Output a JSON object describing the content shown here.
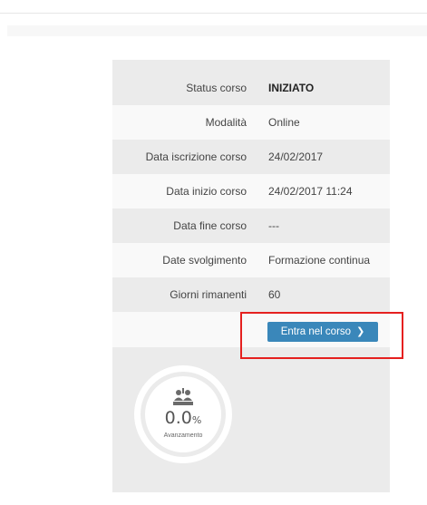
{
  "course_info": {
    "rows": [
      {
        "label": "Status corso",
        "value": "INIZIATO"
      },
      {
        "label": "Modalità",
        "value": "Online"
      },
      {
        "label": "Data iscrizione corso",
        "value": "24/02/2017"
      },
      {
        "label": "Data inizio corso",
        "value": "24/02/2017 11:24"
      },
      {
        "label": "Data fine corso",
        "value": "---"
      },
      {
        "label": "Date svolgimento",
        "value": "Formazione continua"
      },
      {
        "label": "Giorni rimanenti",
        "value": "60"
      }
    ]
  },
  "actions": {
    "enter_label": "Entra nel corso",
    "enter_icon": "chevron-right-icon"
  },
  "progress": {
    "value": "0.0",
    "unit": "%",
    "label": "Avanzamento",
    "icon": "people-icon"
  }
}
